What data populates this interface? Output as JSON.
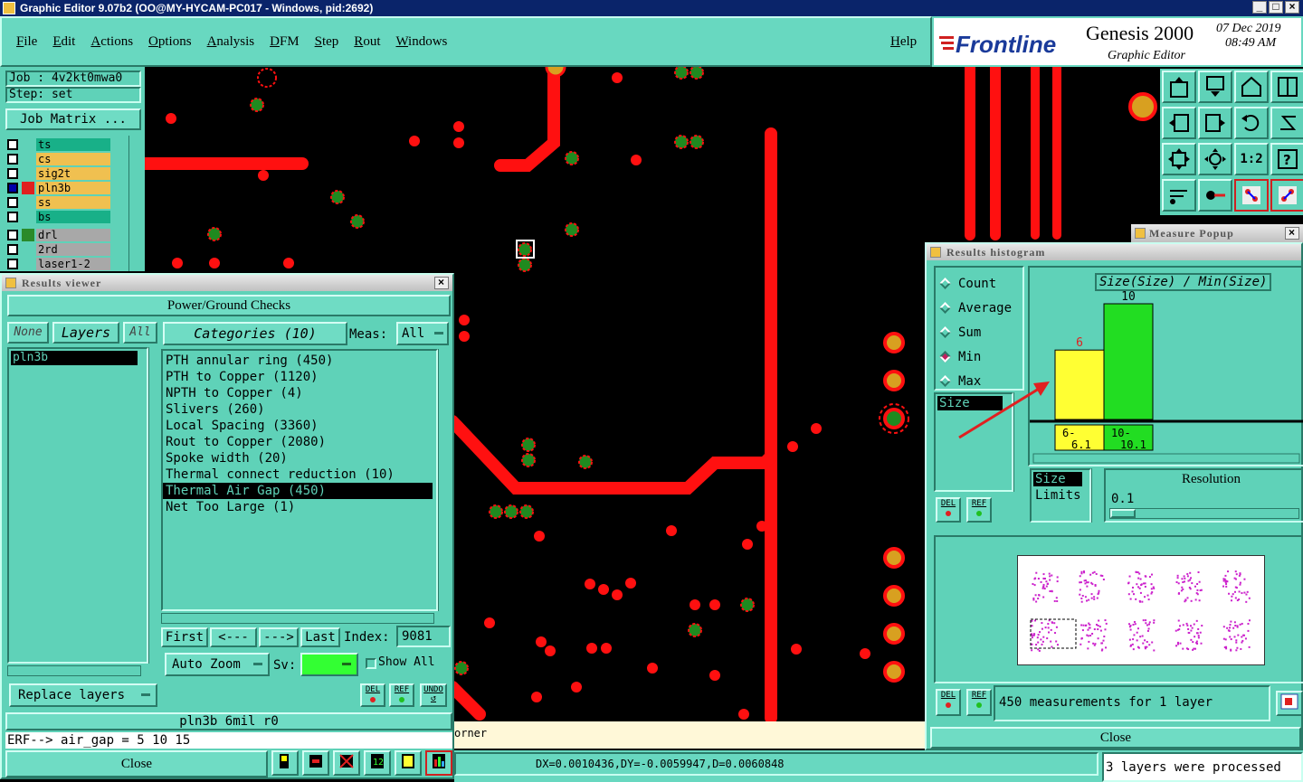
{
  "window": {
    "title": "Graphic Editor 9.07b2 (OO@MY-HYCAM-PC017 - Windows, pid:2692)"
  },
  "menu": {
    "items": [
      "File",
      "Edit",
      "Actions",
      "Options",
      "Analysis",
      "DFM",
      "Step",
      "Rout",
      "Windows"
    ],
    "help": "Help"
  },
  "brand": {
    "logo": "Frontline",
    "product": "Genesis 2000",
    "subtitle": "Graphic Editor",
    "date": "07 Dec 2019",
    "time": "08:49 AM"
  },
  "job": {
    "job_label": "Job : 4v2kt0mwa0",
    "step_label": "Step: set",
    "matrix_button": "Job Matrix ..."
  },
  "layers": [
    {
      "name": "ts",
      "color": "#18b088"
    },
    {
      "name": "cs",
      "color": "#f0c050"
    },
    {
      "name": "sig2t",
      "color": "#f0c050"
    },
    {
      "name": "pln3b",
      "color": "#f0c050",
      "active": true
    },
    {
      "name": "ss",
      "color": "#f0c050"
    },
    {
      "name": "bs",
      "color": "#18b088"
    },
    {
      "name": "drl",
      "color": "#a8a8a8"
    },
    {
      "name": "2rd",
      "color": "#a8a8a8"
    },
    {
      "name": "laser1-2",
      "color": "#a8a8a8"
    }
  ],
  "results_viewer": {
    "title": "Results viewer",
    "header": "Power/Ground Checks",
    "none_btn": "None",
    "layers_btn": "Layers",
    "all_btn": "All",
    "layer_list": [
      "pln3b"
    ],
    "categories_btn": "Categories (10)",
    "meas_label": "Meas:",
    "meas_value": "All",
    "categories": [
      "PTH annular ring (450)",
      "PTH to Copper (1120)",
      "NPTH to Copper (4)",
      "Slivers (260)",
      "Local Spacing (3360)",
      "Rout to Copper (2080)",
      "Spoke width (20)",
      "Thermal connect reduction (10)",
      "Thermal Air Gap (450)",
      "Net Too Large (1)"
    ],
    "selected_category": 8,
    "nav": {
      "first": "First",
      "prev": "<---",
      "next": "--->",
      "last": "Last",
      "index_label": "Index:",
      "index_value": "9081"
    },
    "auto_zoom": "Auto Zoom",
    "sv_label": "Sv:",
    "show_all": "Show All",
    "replace_layers": "Replace layers",
    "del": "DEL",
    "ref": "REF",
    "undo": "UNDO",
    "status": "pln3b 6mil  r0",
    "erf": "ERF--> air_gap = 5 10 15",
    "close": "Close"
  },
  "histogram": {
    "title": "Results histogram",
    "options": [
      "Count",
      "Average",
      "Sum",
      "Min",
      "Max"
    ],
    "selected_option": "Min",
    "field_list": [
      "Size"
    ],
    "chart_title": "Size(Size) / Min(Size)",
    "resolution_label": "Resolution",
    "resolution_value": "0.1",
    "size_label": "Size",
    "limits_label": "Limits",
    "measurements": "450 measurements for 1 layer",
    "close": "Close",
    "del": "DEL",
    "ref": "REF"
  },
  "chart_data": {
    "type": "bar",
    "title": "Size(Size) / Min(Size)",
    "categories": [
      "6-\n6.1",
      "10-\n10.1"
    ],
    "values": [
      6,
      10
    ],
    "colors": [
      "#ffff33",
      "#22dd22"
    ],
    "value_label_colors": [
      "#e02020",
      "#000000"
    ]
  },
  "measure_popup": {
    "title": "Measure Popup"
  },
  "statusbar": {
    "corner_text": "orner",
    "coords": "DX=0.0010436,DY=-0.0059947,D=0.0060848",
    "message": "3 layers were processed"
  },
  "colors": {
    "pcb_bg": "#000000",
    "trace": "#ff1010",
    "pad_green": "#1f8a1f",
    "pad_gold": "#d8a020",
    "panel": "#5fd2b8"
  }
}
